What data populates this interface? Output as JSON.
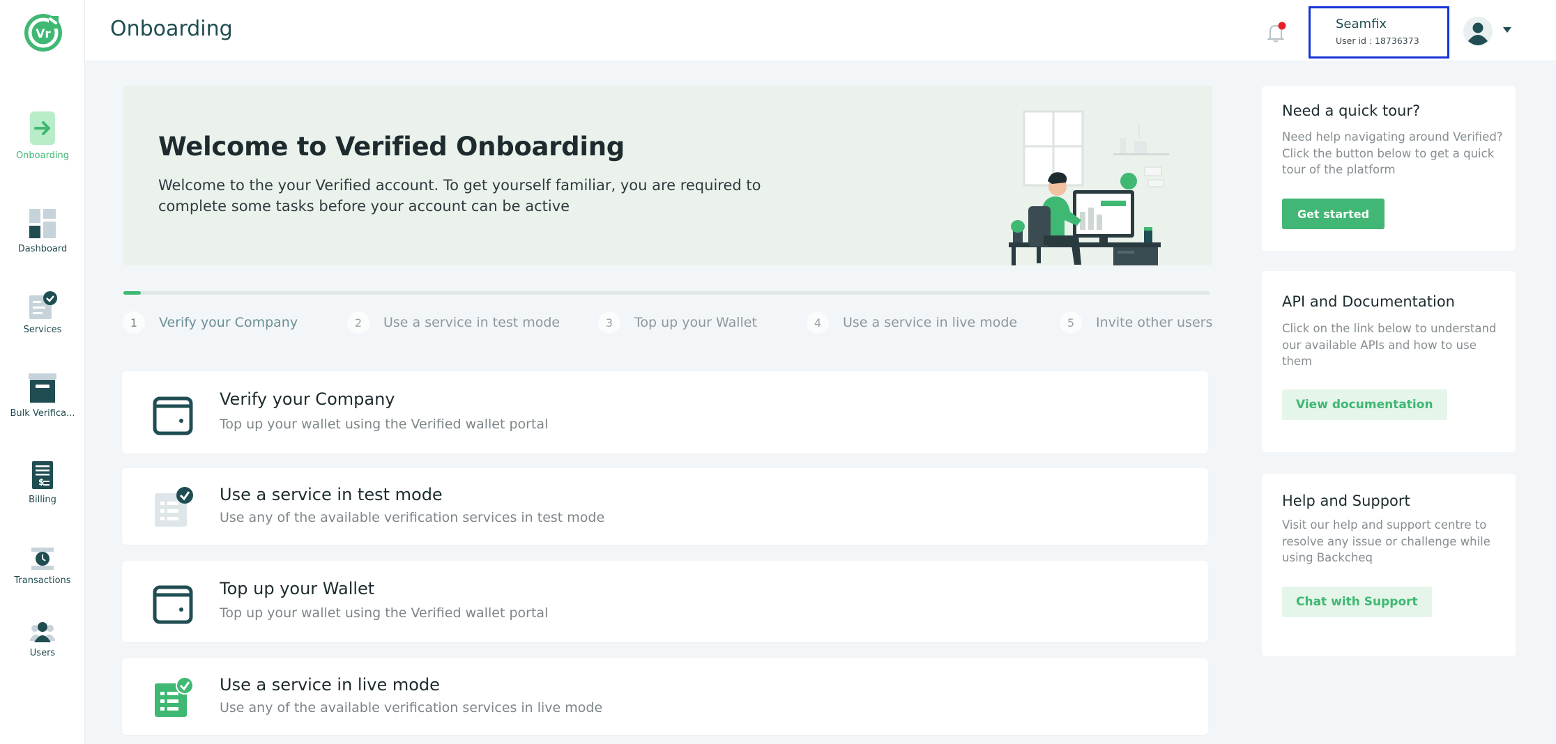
{
  "app": {
    "logo_text": "Vr",
    "accent": "#3fb873",
    "dark": "#1f4d52"
  },
  "sidebar": {
    "items": [
      {
        "label": "Onboarding",
        "icon": "arrow-right-icon",
        "active": true
      },
      {
        "label": "Dashboard",
        "icon": "dashboard-icon"
      },
      {
        "label": "Services",
        "icon": "services-icon"
      },
      {
        "label": "Bulk Verifica...",
        "icon": "archive-box-icon"
      },
      {
        "label": "Billing",
        "icon": "invoice-icon"
      },
      {
        "label": "Transactions",
        "icon": "transactions-icon"
      },
      {
        "label": "Users",
        "icon": "users-icon"
      }
    ]
  },
  "header": {
    "title": "Onboarding",
    "user": {
      "name": "Seamfix",
      "id": "User id : 18736373"
    }
  },
  "hero": {
    "title": "Welcome to Verified Onboarding",
    "text": "Welcome to the your Verified account. To get yourself familiar, you are required to complete some tasks before your account can be active"
  },
  "stepper": {
    "progress": 0.016,
    "steps": [
      {
        "num": "1",
        "label": "Verify your Company"
      },
      {
        "num": "2",
        "label": "Use a service in test mode"
      },
      {
        "num": "3",
        "label": "Top up your Wallet"
      },
      {
        "num": "4",
        "label": "Use a service in live mode"
      },
      {
        "num": "5",
        "label": "Invite other users"
      }
    ]
  },
  "tasks": [
    {
      "title": "Verify your Company",
      "desc": "Top up your wallet using the Verified wallet portal",
      "icon": "wallet-icon"
    },
    {
      "title": "Use a service in test mode",
      "desc": "Use any of the available verification services in test mode",
      "icon": "checklist-gray-icon"
    },
    {
      "title": "Top up your Wallet",
      "desc": "Top up your wallet using the Verified wallet portal",
      "icon": "wallet-icon"
    },
    {
      "title": "Use a service in live mode",
      "desc": "Use any of the available verification services in live mode",
      "icon": "checklist-green-icon"
    }
  ],
  "right": {
    "tour": {
      "title": "Need a quick tour?",
      "text": "Need help navigating around Verified? Click the button below to get a quick tour of the platform",
      "button": "Get started"
    },
    "api": {
      "title": "API and Documentation",
      "text": "Click on the link below to understand our available APIs and how to use them",
      "button": "View documentation"
    },
    "support": {
      "title": "Help and Support",
      "text": "Visit our help and support centre to resolve any issue or challenge while using Backcheq",
      "button": "Chat with Support"
    }
  }
}
